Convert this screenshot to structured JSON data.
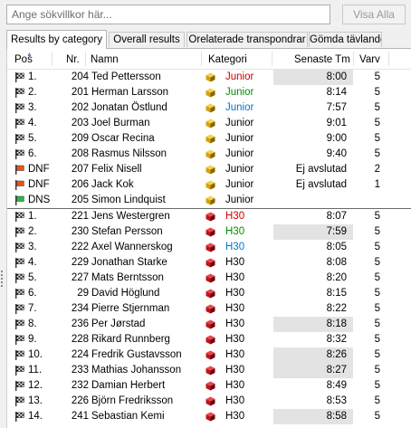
{
  "search": {
    "placeholder": "Ange sökvillkor här...",
    "value": ""
  },
  "show_all_label": "Visa Alla",
  "tabs": [
    {
      "label": "Results by category",
      "active": true
    },
    {
      "label": "Overall results",
      "active": false
    },
    {
      "label": "Orelaterade transpondrar",
      "active": false
    },
    {
      "label": "Gömda tävlande",
      "active": false
    }
  ],
  "columns": {
    "pos": "Pos",
    "nr": "Nr.",
    "name": "Namn",
    "category": "Kategori",
    "last_time": "Senaste Tm",
    "laps": "Varv"
  },
  "colors": {
    "junior_icon": "#d4a20c",
    "h30_icon": "#c0141c",
    "highlight": "#e3e3e3",
    "red_text": "#cc0000",
    "green_text": "#008f00",
    "blue_text": "#0077cc"
  },
  "rows": [
    {
      "flag": "checkered",
      "pos": "1.",
      "nr": "204",
      "name": "Ted Pettersson",
      "icon": "junior-cube-icon",
      "category": "Junior",
      "category_color": "red",
      "time": "8:00",
      "highlight": true,
      "laps": "5"
    },
    {
      "flag": "checkered",
      "pos": "2.",
      "nr": "201",
      "name": "Herman Larsson",
      "icon": "junior-cube-icon",
      "category": "Junior",
      "category_color": "green",
      "time": "8:14",
      "highlight": false,
      "laps": "5"
    },
    {
      "flag": "checkered",
      "pos": "3.",
      "nr": "202",
      "name": "Jonatan Östlund",
      "icon": "junior-cube-icon",
      "category": "Junior",
      "category_color": "blue",
      "time": "7:57",
      "highlight": false,
      "laps": "5"
    },
    {
      "flag": "checkered",
      "pos": "4.",
      "nr": "203",
      "name": "Joel Burman",
      "icon": "junior-cube-icon",
      "category": "Junior",
      "category_color": "black",
      "time": "9:01",
      "highlight": false,
      "laps": "5"
    },
    {
      "flag": "checkered",
      "pos": "5.",
      "nr": "209",
      "name": "Oscar Recina",
      "icon": "junior-cube-icon",
      "category": "Junior",
      "category_color": "black",
      "time": "9:00",
      "highlight": false,
      "laps": "5"
    },
    {
      "flag": "checkered",
      "pos": "6.",
      "nr": "208",
      "name": "Rasmus Nilsson",
      "icon": "junior-cube-icon",
      "category": "Junior",
      "category_color": "black",
      "time": "9:40",
      "highlight": false,
      "laps": "5"
    },
    {
      "flag": "dnf",
      "pos": "DNF",
      "nr": "207",
      "name": "Felix Nisell",
      "icon": "junior-cube-icon",
      "category": "Junior",
      "category_color": "black",
      "time": "Ej avslutad",
      "highlight": false,
      "laps": "2"
    },
    {
      "flag": "dnf",
      "pos": "DNF",
      "nr": "206",
      "name": "Jack Kok",
      "icon": "junior-cube-icon",
      "category": "Junior",
      "category_color": "black",
      "time": "Ej avslutad",
      "highlight": false,
      "laps": "1"
    },
    {
      "flag": "dns",
      "pos": "DNS",
      "nr": "205",
      "name": "Simon Lindquist",
      "icon": "junior-cube-icon",
      "category": "Junior",
      "category_color": "black",
      "time": "",
      "highlight": false,
      "laps": ""
    },
    {
      "flag": "checkered",
      "pos": "1.",
      "nr": "221",
      "name": "Jens Westergren",
      "icon": "h30-cube-icon",
      "category": "H30",
      "category_color": "red",
      "time": "8:07",
      "highlight": false,
      "laps": "5",
      "group_start": true
    },
    {
      "flag": "checkered",
      "pos": "2.",
      "nr": "230",
      "name": "Stefan Persson",
      "icon": "h30-cube-icon",
      "category": "H30",
      "category_color": "green",
      "time": "7:59",
      "highlight": true,
      "laps": "5"
    },
    {
      "flag": "checkered",
      "pos": "3.",
      "nr": "222",
      "name": "Axel Wannerskog",
      "icon": "h30-cube-icon",
      "category": "H30",
      "category_color": "blue",
      "time": "8:05",
      "highlight": false,
      "laps": "5"
    },
    {
      "flag": "checkered",
      "pos": "4.",
      "nr": "229",
      "name": "Jonathan Starke",
      "icon": "h30-cube-icon",
      "category": "H30",
      "category_color": "black",
      "time": "8:08",
      "highlight": false,
      "laps": "5"
    },
    {
      "flag": "checkered",
      "pos": "5.",
      "nr": "227",
      "name": "Mats Berntsson",
      "icon": "h30-cube-icon",
      "category": "H30",
      "category_color": "black",
      "time": "8:20",
      "highlight": false,
      "laps": "5"
    },
    {
      "flag": "checkered",
      "pos": "6.",
      "nr": "29",
      "name": "David Höglund",
      "icon": "h30-cube-icon",
      "category": "H30",
      "category_color": "black",
      "time": "8:15",
      "highlight": false,
      "laps": "5"
    },
    {
      "flag": "checkered",
      "pos": "7.",
      "nr": "234",
      "name": "Pierre Stjernman",
      "icon": "h30-cube-icon",
      "category": "H30",
      "category_color": "black",
      "time": "8:22",
      "highlight": false,
      "laps": "5"
    },
    {
      "flag": "checkered",
      "pos": "8.",
      "nr": "236",
      "name": "Per Jørstad",
      "icon": "h30-cube-icon",
      "category": "H30",
      "category_color": "black",
      "time": "8:18",
      "highlight": true,
      "laps": "5"
    },
    {
      "flag": "checkered",
      "pos": "9.",
      "nr": "228",
      "name": "Rikard Runnberg",
      "icon": "h30-cube-icon",
      "category": "H30",
      "category_color": "black",
      "time": "8:32",
      "highlight": false,
      "laps": "5"
    },
    {
      "flag": "checkered",
      "pos": "10.",
      "nr": "224",
      "name": "Fredrik Gustavsson",
      "icon": "h30-cube-icon",
      "category": "H30",
      "category_color": "black",
      "time": "8:26",
      "highlight": true,
      "laps": "5"
    },
    {
      "flag": "checkered",
      "pos": "11.",
      "nr": "233",
      "name": "Mathias Johansson",
      "icon": "h30-cube-icon",
      "category": "H30",
      "category_color": "black",
      "time": "8:27",
      "highlight": true,
      "laps": "5"
    },
    {
      "flag": "checkered",
      "pos": "12.",
      "nr": "232",
      "name": "Damian Herbert",
      "icon": "h30-cube-icon",
      "category": "H30",
      "category_color": "black",
      "time": "8:49",
      "highlight": false,
      "laps": "5"
    },
    {
      "flag": "checkered",
      "pos": "13.",
      "nr": "226",
      "name": "Björn Fredriksson",
      "icon": "h30-cube-icon",
      "category": "H30",
      "category_color": "black",
      "time": "8:53",
      "highlight": false,
      "laps": "5"
    },
    {
      "flag": "checkered",
      "pos": "14.",
      "nr": "241",
      "name": "Sebastian Kemi",
      "icon": "h30-cube-icon",
      "category": "H30",
      "category_color": "black",
      "time": "8:58",
      "highlight": true,
      "laps": "5"
    }
  ]
}
